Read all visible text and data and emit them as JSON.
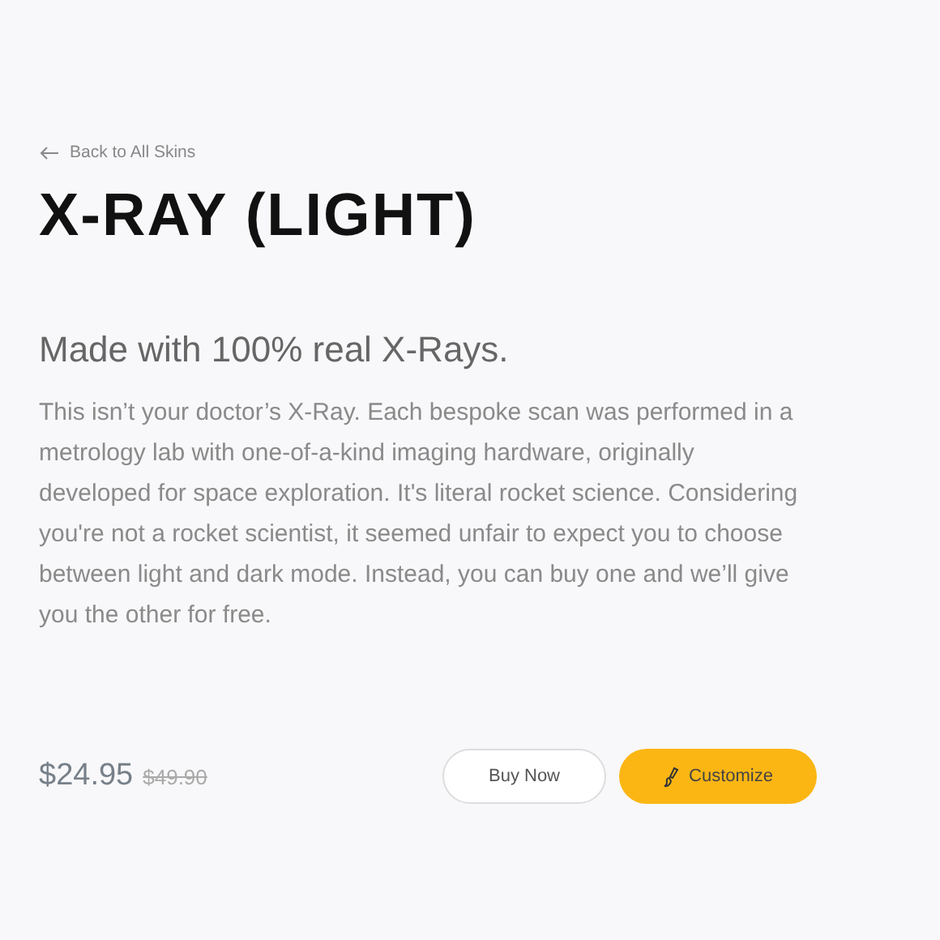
{
  "back_link": {
    "label": "Back to All Skins"
  },
  "title": "X-RAY (LIGHT)",
  "subtitle": "Made with 100% real X-Rays.",
  "description": "This isn’t your doctor’s X-Ray. Each bespoke scan was performed in a metrology lab with one-of-a-kind imaging hardware, originally developed for space exploration. It's literal rocket science. Considering you're not a rocket scientist, it seemed unfair to expect you to choose between light and dark mode. Instead, you can buy one and we’ll give you the other for free.",
  "price": {
    "current": "$24.95",
    "original": "$49.90"
  },
  "buttons": [
    {
      "label": "Buy Now",
      "kind": "outline"
    },
    {
      "label": "Customize",
      "kind": "primary"
    }
  ]
}
